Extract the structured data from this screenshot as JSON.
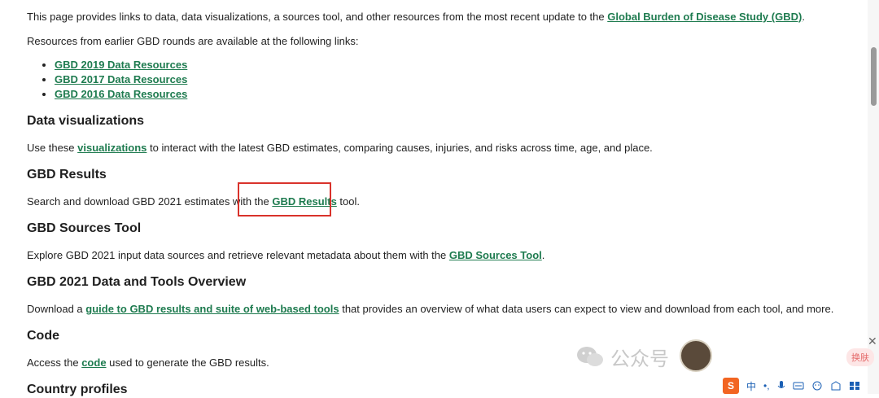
{
  "intro": {
    "text_before": "This page provides links to data, data visualizations, a sources tool, and other resources from the most recent update to the ",
    "link": "Global Burden of Disease Study (GBD)",
    "text_after": "."
  },
  "earlier": {
    "text": "Resources from earlier GBD rounds are available at the following links:",
    "links": [
      "GBD 2019 Data Resources",
      "GBD 2017 Data Resources",
      "GBD 2016 Data Resources"
    ]
  },
  "sections": {
    "viz": {
      "heading": "Data visualizations",
      "before": "Use these ",
      "link": "visualizations",
      "after": " to interact with the latest GBD estimates, comparing causes, injuries, and risks across time, age, and place."
    },
    "results": {
      "heading": "GBD Results",
      "before": "Search and download GBD 2021 estimates with the ",
      "link": "GBD Results",
      "after": " tool."
    },
    "sources": {
      "heading": "GBD Sources Tool",
      "before": "Explore GBD 2021 input data sources and retrieve relevant metadata about them with the ",
      "link": "GBD Sources Tool",
      "after": "."
    },
    "overview": {
      "heading": "GBD 2021 Data and Tools Overview",
      "before": "Download a ",
      "link": "guide to GBD results and suite of web-based tools",
      "after": " that provides an overview of what data users can expect to view and download from each tool, and more."
    },
    "code": {
      "heading": "Code",
      "before": "Access the ",
      "link": "code",
      "after": " used to generate the GBD results."
    },
    "country": {
      "heading": "Country profiles"
    }
  },
  "watermark": {
    "text": "公众号"
  },
  "ime": {
    "logo": "S",
    "mode": "中",
    "punct": "•,"
  },
  "overlay": {
    "close": "✕",
    "pill": "换肤"
  }
}
